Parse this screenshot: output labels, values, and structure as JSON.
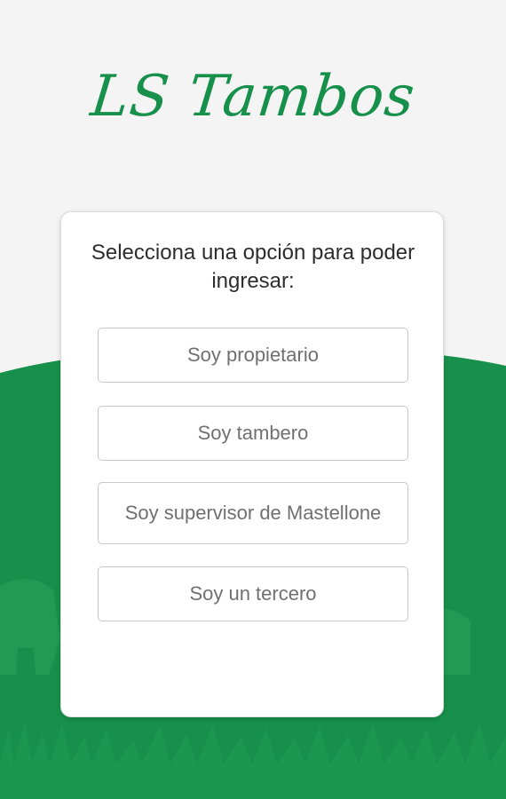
{
  "app": {
    "logo_text": "LS Tambos"
  },
  "colors": {
    "brand_green": "#17904b",
    "background": "#f4f4f4"
  },
  "login_card": {
    "prompt": "Selecciona una opción para poder ingresar:",
    "options": [
      {
        "label": "Soy propietario"
      },
      {
        "label": "Soy tambero"
      },
      {
        "label": "Soy supervisor de Mastellone"
      },
      {
        "label": "Soy un tercero"
      }
    ]
  }
}
